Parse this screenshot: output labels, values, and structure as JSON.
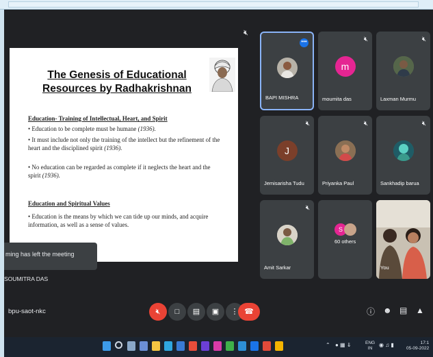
{
  "slide": {
    "title": "The Genesis of Educational Resources by Radhakrishnan",
    "section1_heading": "Education- Training of Intellectual, Heart, and Spirit",
    "bullet1_text": "Education to be complete must be humane ",
    "bullet1_year": "(1936).",
    "bullet2_text": "It must include not only the training of the intellect but the refinement of the heart and the disciplined spirit ",
    "bullet2_year": "(1936).",
    "bullet3_text": "No education can be regarded as complete if it neglects the heart and the spirit ",
    "bullet3_year": "(1936).",
    "section2_heading": "Education and Spiritual Values",
    "bullet4_text": "Education is the means by which we can tide up our minds, and acquire information, as well as a sense of values."
  },
  "toast": {
    "text": "ming has left the meeting"
  },
  "presenter": {
    "name": "SOUMITRA DAS"
  },
  "participants": [
    {
      "name": "BAPI MISHRA",
      "type": "photo",
      "active": true,
      "icon": "more-options-icon"
    },
    {
      "name": "moumita das",
      "type": "initial",
      "initial": "m",
      "color": "#e52592",
      "icon": "mic-off-icon"
    },
    {
      "name": "Laxman Murmu",
      "type": "photo",
      "icon": "mic-off-icon"
    },
    {
      "name": "Jemisarisha Tudu",
      "type": "initial",
      "initial": "J",
      "color": "#7b3f2a",
      "icon": "mic-off-icon"
    },
    {
      "name": "Priyanka Paul",
      "type": "photo",
      "icon": "mic-off-icon"
    },
    {
      "name": "Sankhadip barua",
      "type": "photo",
      "icon": "mic-off-icon"
    },
    {
      "name": "Amit Sarkar",
      "type": "photo",
      "icon": "mic-off-icon"
    },
    {
      "name": "60 others",
      "type": "group",
      "initial": "S",
      "color": "#e52592"
    },
    {
      "name": "You",
      "type": "video"
    }
  ],
  "controls": {
    "meeting_code": "bpu-saot-nkc"
  },
  "tray": {
    "lang1": "ENG",
    "lang2": "IN",
    "time": "17:1",
    "date": "05-09-2022"
  },
  "colors": {
    "end_call": "#ea4335",
    "mic_off": "#ea4335",
    "accent": "#8ab4f8"
  }
}
